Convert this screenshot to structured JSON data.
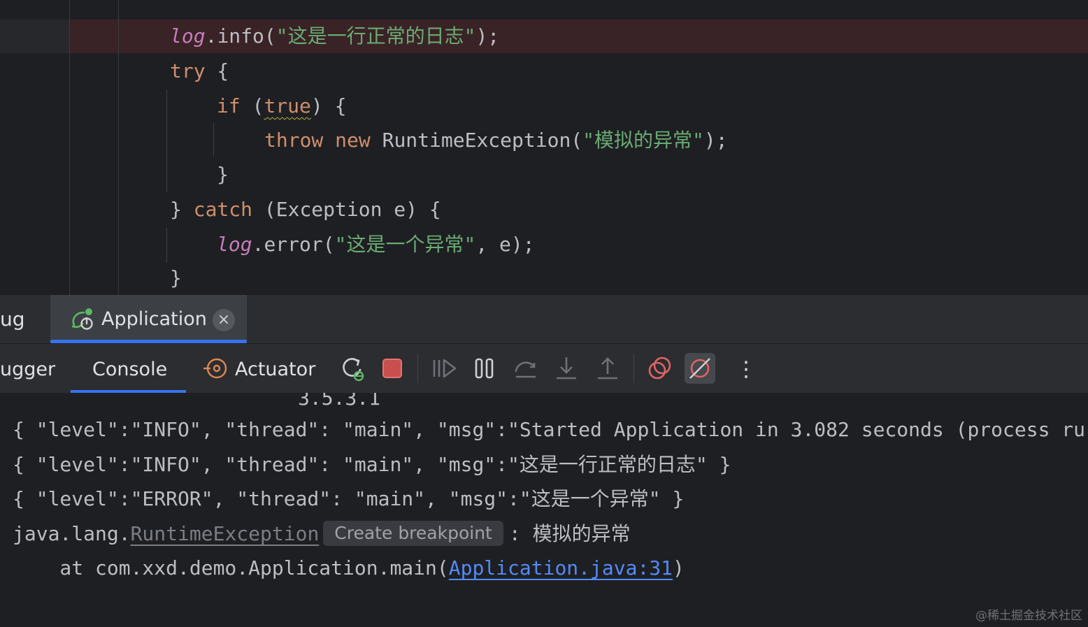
{
  "editor": {
    "line1": {
      "obj": "log",
      "dot": ".",
      "method": "info(",
      "str": "\"这是一行正常的日志\"",
      "end": ");"
    },
    "line2": {
      "kw": "try",
      "rest": " {"
    },
    "line3": {
      "kw": "if",
      "open": " (",
      "val": "true",
      "close": ") {"
    },
    "line4": {
      "kw1": "throw",
      "kw2": "new",
      "cls": " RuntimeException(",
      "str": "\"模拟的异常\"",
      "end": ");"
    },
    "line5": {
      "text": "}"
    },
    "line6": {
      "start": "} ",
      "kw": "catch",
      "rest": " (Exception e) {"
    },
    "line7": {
      "obj": "log",
      "dot": ".",
      "method": "error(",
      "str": "\"这是一个异常\"",
      "end": ", e);"
    },
    "line8": {
      "text": "}"
    }
  },
  "run_panel": {
    "cut_tab_label": "ug",
    "app_tab_label": "Application",
    "close_glyph": "×"
  },
  "toolbar": {
    "debugger_label": "ugger",
    "console_label": "Console",
    "actuator_label": "Actuator",
    "more_glyph": "⋮"
  },
  "console": {
    "cut_line": "3.5.3.1",
    "line1": "{ \"level\":\"INFO\", \"thread\": \"main\", \"msg\":\"Started Application in 3.082 seconds (process ru",
    "line2": "{ \"level\":\"INFO\", \"thread\": \"main\", \"msg\":\"这是一行正常的日志\" }",
    "line3": "{ \"level\":\"ERROR\", \"thread\": \"main\", \"msg\":\"这是一个异常\" }",
    "exc_prefix": "java.lang.",
    "exc_class": "RuntimeException",
    "bp_popup": "Create breakpoint",
    "exc_msg": ": 模拟的异常",
    "at_prefix": "    at com.xxd.demo.Application.main(",
    "at_link": "Application.java:31",
    "at_suffix": ")"
  },
  "watermark": "@稀土掘金技术社区",
  "colors": {
    "keyword": "#cf8e6d",
    "string": "#6aab73",
    "field": "#c77dbb",
    "accent": "#3574f0",
    "link": "#548af7",
    "stop": "#db5c5c",
    "run_green": "#5fb865"
  }
}
